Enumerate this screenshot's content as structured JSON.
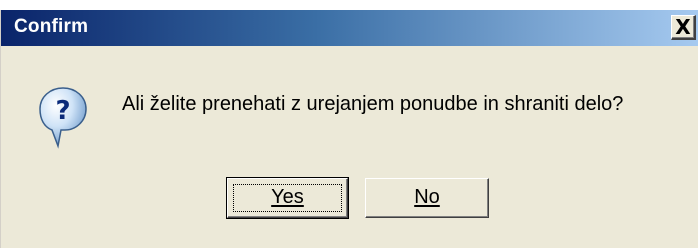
{
  "window": {
    "title": "Confirm",
    "close_symbol": "X"
  },
  "dialog": {
    "icon": "question-icon",
    "message": "Ali želite prenehati z urejanjem ponudbe in shraniti delo?"
  },
  "buttons": {
    "yes_label": "Yes",
    "no_label": "No",
    "default": "yes"
  },
  "colors": {
    "titlebar_start": "#0a246a",
    "titlebar_end": "#a6caf0",
    "dialog_background": "#ece9d8"
  }
}
